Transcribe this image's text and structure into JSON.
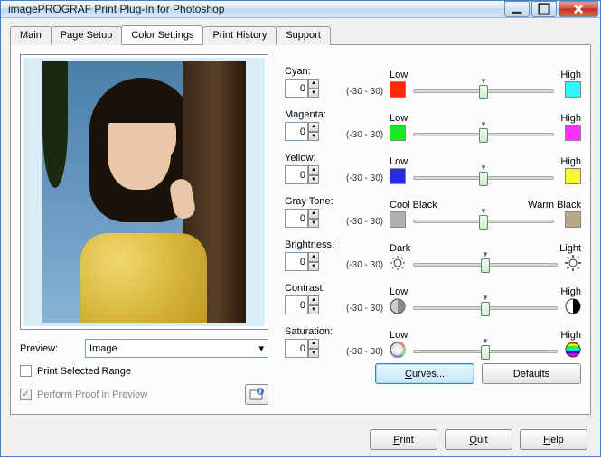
{
  "window": {
    "title": "imagePROGRAF Print Plug-In for Photoshop"
  },
  "tabs": [
    "Main",
    "Page Setup",
    "Color Settings",
    "Print History",
    "Support"
  ],
  "active_tab": 2,
  "preview": {
    "label": "Preview:",
    "value": "Image",
    "print_selected": {
      "label": "Print Selected Range",
      "checked": false,
      "enabled": true
    },
    "proof": {
      "label": "Perform Proof in Preview",
      "checked": true,
      "enabled": false
    }
  },
  "range_text": "(-30 - 30)",
  "adjustments": {
    "cyan": {
      "label": "Cyan:",
      "value": 0,
      "low": "Low",
      "high": "High",
      "lowColor": "#ff2a00",
      "highColor": "#30f8f8"
    },
    "magenta": {
      "label": "Magenta:",
      "value": 0,
      "low": "Low",
      "high": "High",
      "lowColor": "#20e820",
      "highColor": "#f830f8"
    },
    "yellow": {
      "label": "Yellow:",
      "value": 0,
      "low": "Low",
      "high": "High",
      "lowColor": "#2828e8",
      "highColor": "#f8f830"
    },
    "gray": {
      "label": "Gray Tone:",
      "value": 0,
      "low": "Cool Black",
      "high": "Warm Black",
      "lowColor": "#b0b0b0",
      "highColor": "#b8a888"
    },
    "brightness": {
      "label": "Brightness:",
      "value": 0,
      "low": "Dark",
      "high": "Light"
    },
    "contrast": {
      "label": "Contrast:",
      "value": 0,
      "low": "Low",
      "high": "High"
    },
    "saturation": {
      "label": "Saturation:",
      "value": 0,
      "low": "Low",
      "high": "High"
    }
  },
  "buttons": {
    "curves": "Curves...",
    "defaults": "Defaults",
    "print": "Print",
    "quit": "Quit",
    "help": "Help"
  }
}
